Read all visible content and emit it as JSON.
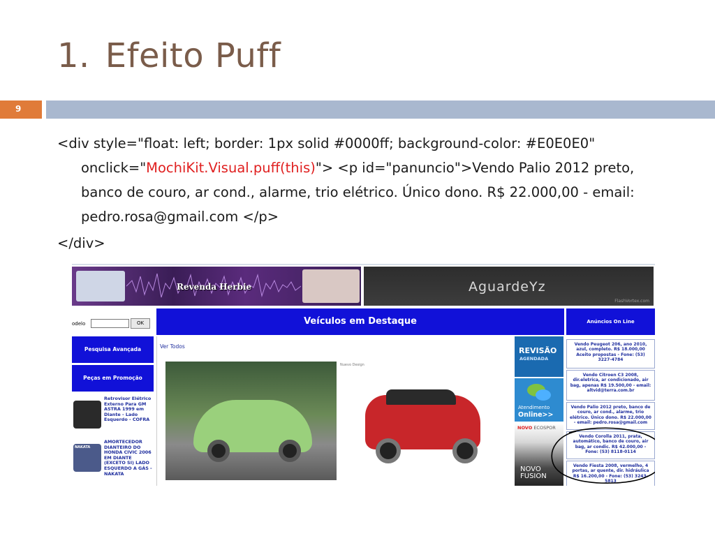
{
  "slide": {
    "title_number": "1.",
    "title_text": "Efeito Puff",
    "slide_number": "9",
    "code_line1": "<div  style=\"float: left; border: 1px solid #0000ff; background-color: #E0E0E0\" onclick=\"",
    "code_highlight": "MochiKit.Visual.puff(this)",
    "code_line1_rest": "\"> <p id=\"panuncio\">Vendo Palio 2012 preto, banco de couro, ar cond., alarme, trio elétrico. Único dono. R$ 22.000,00 - email: pedro.rosa@gmail.com </p>",
    "code_close": "</div>",
    "colors": {
      "title": "#7a5c4a",
      "accent_tab": "#e07b39",
      "bar": "#a9b8cf",
      "highlight": "#e02020"
    }
  },
  "site": {
    "banner_left_text": "Revenda Herbie",
    "banner_right_text": "AguardeYz",
    "flashvortex": "FlashVortex.com",
    "modelo_label": "odelo",
    "ok_label": "OK",
    "nav_search": "Pesquisa Avançada",
    "nav_promo": "Peças em Promoção",
    "promo_items": [
      "Retrovisor Elétrico Externo Para GM ASTRA 1999 em Diante - Lado Esquerdo - COFRA",
      "AMORTECEDOR DIANTEIRO DO HONDA CIVIC 2006 EM DIANTE (EXCETO SI) LADO ESQUERDO A GÁS - NAKATA"
    ],
    "promo_logo": "NAKATA",
    "center_title": "Veículos em Destaque",
    "ver_todos": "Ver Todos",
    "car2_caption": "Nuevo Design",
    "ad_revisao_title": "REVISÃO",
    "ad_revisao_sub": "AGENDADA",
    "ad_atend_title": "Atendimento",
    "ad_atend_sub": "Online>>",
    "ad_eco_prefix": "NOVO",
    "ad_eco_name": "ECOSPOR",
    "ad_eco_big1": "NOVO",
    "ad_eco_big2": "FUSION",
    "right_header": "Anúncios On Line",
    "right_ads": [
      "Vendo Peugeot 206, ano 2010, azul, completo. R$ 18.000,00 Aceito propostas - Fone: (53) 3227-4784",
      "Vendo Citroen C3 2008, dir.eletrica, ar condicionado, air bag, apenas R$ 19.500,00 - email: altvid@terra.com.br",
      "Vendo Palio 2012 preto, banco de couro, ar cond., alarme, trio elétrico. Único dono. R$ 22.000,00 - email: pedro.rosa@gmail.com",
      "Vendo Corolla 2011, prata, automático, banco de couro, air bag, ar condic. R$ 42.000,00 - Fone: (53) 8118-0114",
      "Vendo Fiesta 2008, vermelho, 4 portas, ar quente, dir. hidráulica R$ 16.200,00 - Fone: (53) 3243-5813"
    ]
  }
}
